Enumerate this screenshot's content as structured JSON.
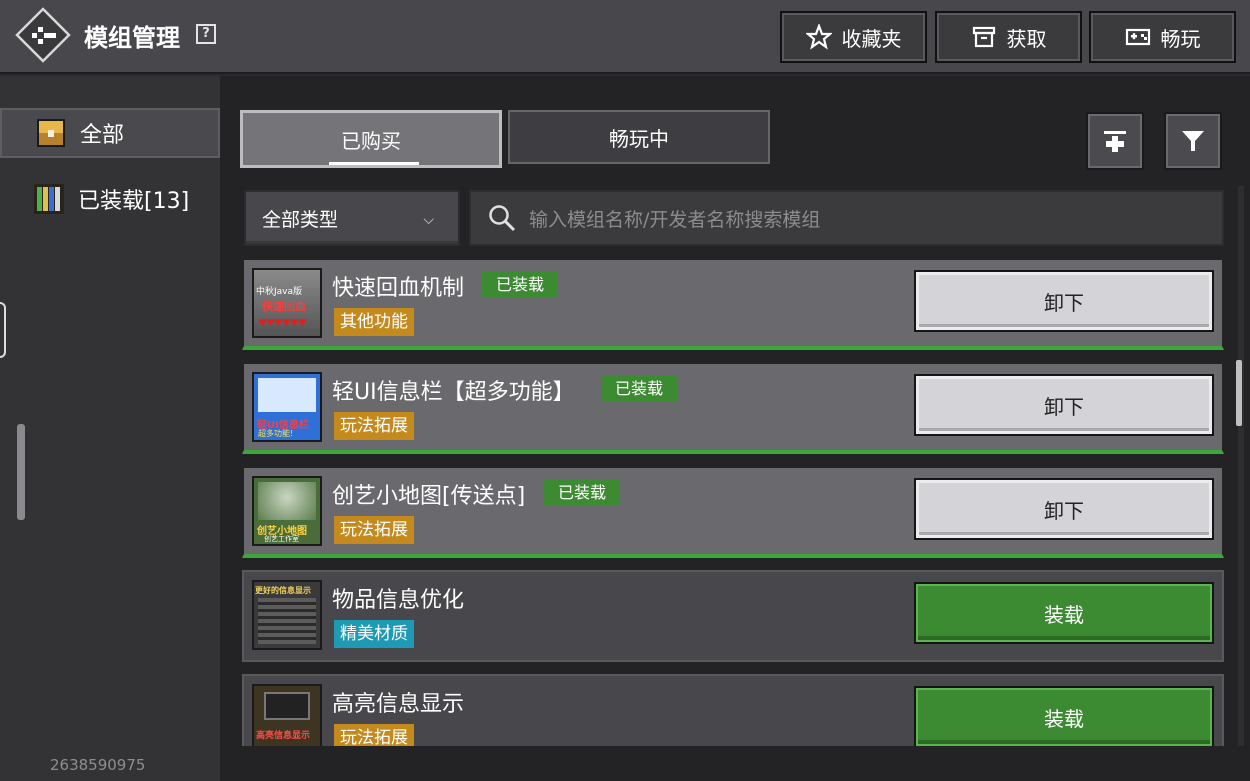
{
  "header": {
    "title": "模组管理",
    "help": "?",
    "buttons": [
      {
        "label": "收藏夹",
        "icon": "star-icon"
      },
      {
        "label": "获取",
        "icon": "archive-icon"
      },
      {
        "label": "畅玩",
        "icon": "gamepad-icon"
      }
    ]
  },
  "sidebar": {
    "items": [
      {
        "label": "全部",
        "icon": "chest-icon",
        "active": true
      },
      {
        "label": "已装载[13]",
        "icon": "bookshelf-icon",
        "active": false
      }
    ],
    "uid": "2638590975"
  },
  "tabs": [
    {
      "label": "已购买",
      "active": true
    },
    {
      "label": "畅玩中",
      "active": false
    }
  ],
  "tools": [
    {
      "icon": "pin-top-icon"
    },
    {
      "icon": "filter-icon"
    }
  ],
  "filter": {
    "type_label": "全部类型",
    "search_placeholder": "输入模组名称/开发者名称搜索模组"
  },
  "mods": [
    {
      "name": "快速回血机制",
      "installed": true,
      "installed_label": "已装载",
      "category": "其他功能",
      "category_color": "#c48a1e",
      "action": "卸下",
      "thumb_text": [
        "中秋Java版",
        "快速回血"
      ]
    },
    {
      "name": "轻UI信息栏【超多功能】",
      "installed": true,
      "installed_label": "已装载",
      "category": "玩法拓展",
      "category_color": "#c48a1e",
      "action": "卸下",
      "thumb_text": [
        "轻UI信息栏",
        "超多功能!"
      ]
    },
    {
      "name": "创艺小地图[传送点]",
      "installed": true,
      "installed_label": "已装载",
      "category": "玩法拓展",
      "category_color": "#c48a1e",
      "action": "卸下",
      "thumb_text": [
        "创艺小地图",
        "创艺工作室"
      ]
    },
    {
      "name": "物品信息优化",
      "installed": false,
      "installed_label": "",
      "category": "精美材质",
      "category_color": "#1e9ab4",
      "action": "装载",
      "thumb_text": [
        "更好的信息显示",
        ""
      ]
    },
    {
      "name": "高亮信息显示",
      "installed": false,
      "installed_label": "",
      "category": "玩法拓展",
      "category_color": "#c48a1e",
      "action": "装载",
      "thumb_text": [
        "高亮信息显示",
        ""
      ]
    }
  ],
  "colors": {
    "installed_green": "#3c8a31",
    "tag_orange": "#c48a1e",
    "tag_cyan": "#1e9ab4"
  }
}
